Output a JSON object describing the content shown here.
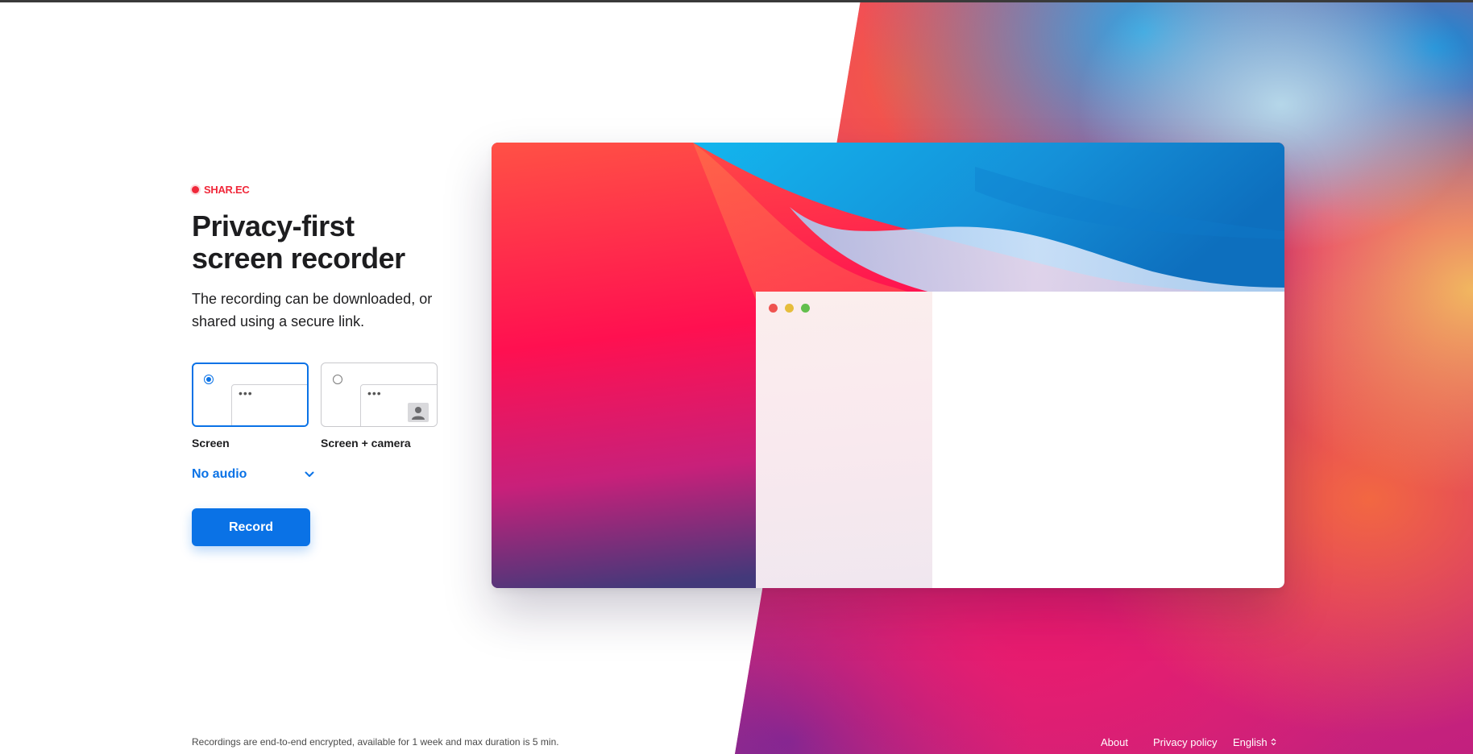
{
  "brand": {
    "name": "SHAR.EC",
    "color": "#f0283a"
  },
  "hero": {
    "title_line1": "Privacy-first",
    "title_line2": "screen recorder",
    "subtitle": "The recording can be downloaded, or shared using a secure link."
  },
  "options": [
    {
      "label": "Screen",
      "selected": true
    },
    {
      "label": "Screen + camera",
      "selected": false
    }
  ],
  "audio": {
    "label": "No audio"
  },
  "record_button": {
    "label": "Record"
  },
  "footer": {
    "note": "Recordings are end-to-end encrypted, available for 1 week and max duration is 5 min.",
    "about": "About",
    "privacy": "Privacy policy",
    "language": "English"
  },
  "colors": {
    "accent": "#0a72e6",
    "window_close": "#ef5350",
    "window_minimize": "#e6bd3c",
    "window_zoom": "#63bf4d"
  },
  "icons": {
    "brand": "record-dot-icon",
    "audio_toggle": "chevron-down-icon",
    "camera": "person-icon",
    "language_toggle": "up-down-chevron-icon"
  }
}
